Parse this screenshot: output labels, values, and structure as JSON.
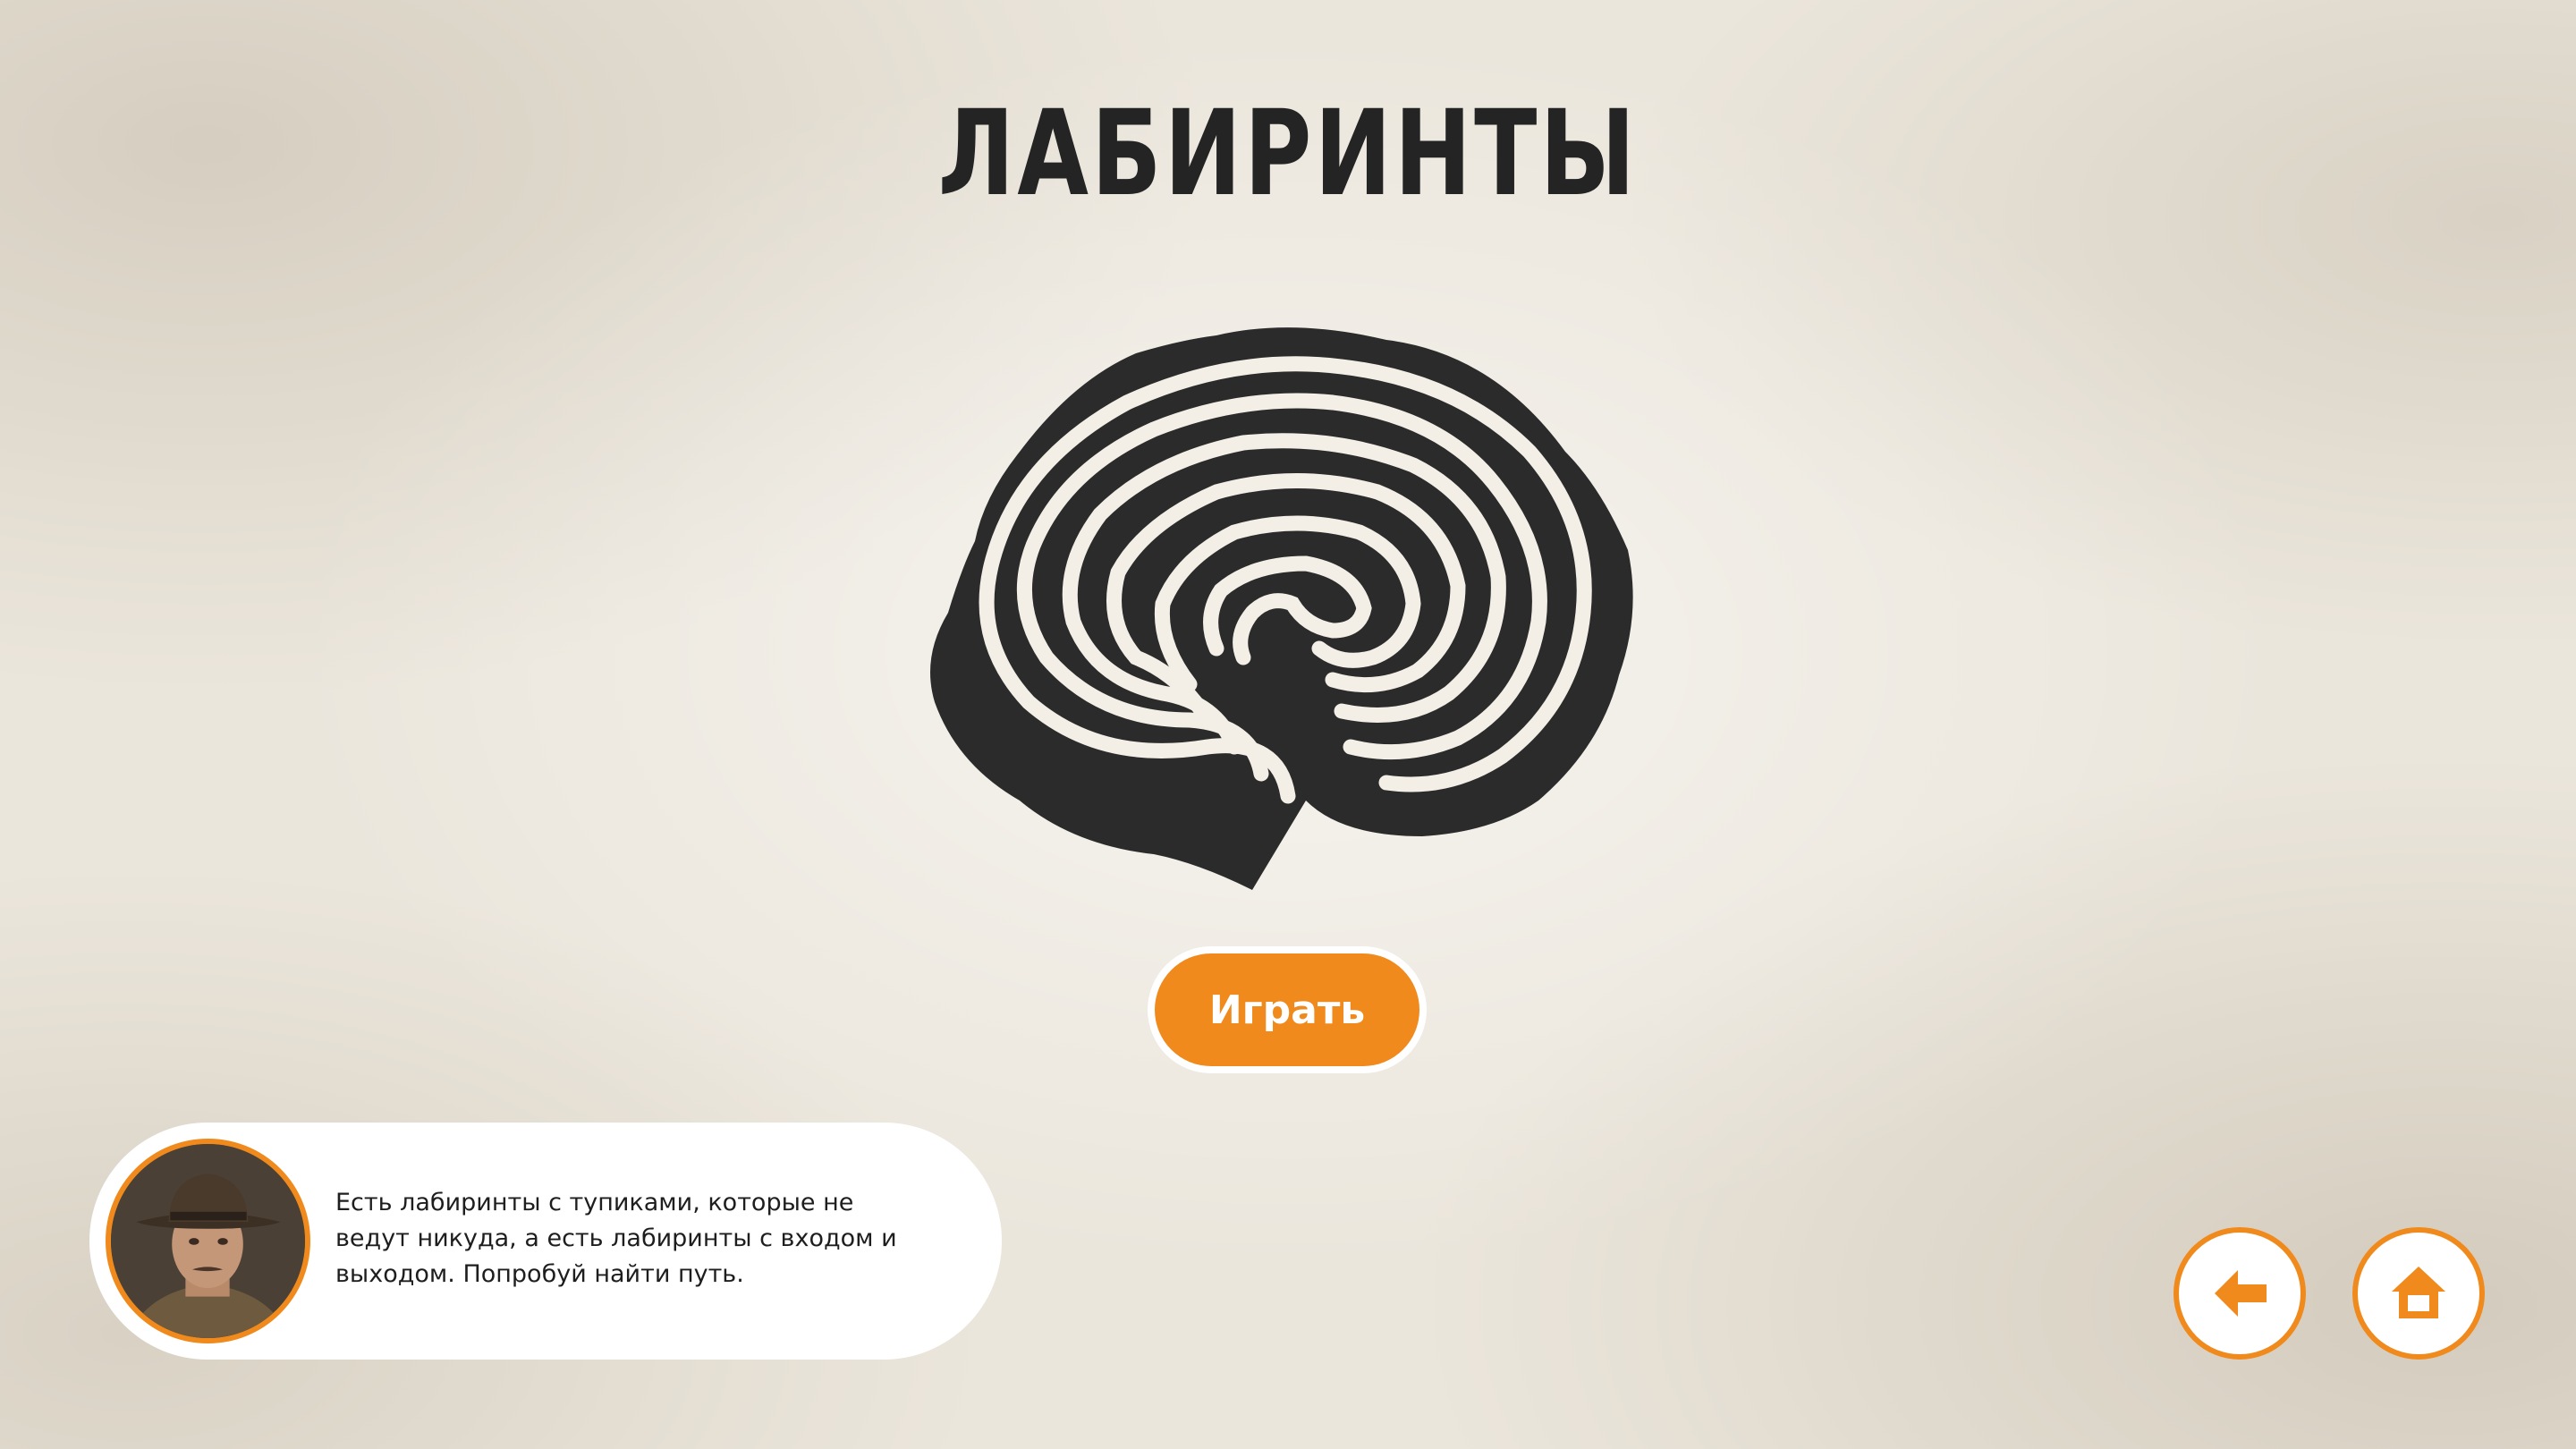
{
  "page": {
    "title": "ЛАБИРИНТЫ"
  },
  "play": {
    "label": "Играть"
  },
  "dialog": {
    "lines": [
      "Есть лабиринты с тупиками, которые не",
      "ведут никуда, а есть лабиринты с входом и",
      "выходом. Попробуй найти путь."
    ]
  },
  "nav": {
    "back_icon": "arrow-left-icon",
    "home_icon": "home-icon"
  },
  "colors": {
    "accent": "#f08a1c",
    "ink": "#242424",
    "paper": "#ebe6dc"
  }
}
